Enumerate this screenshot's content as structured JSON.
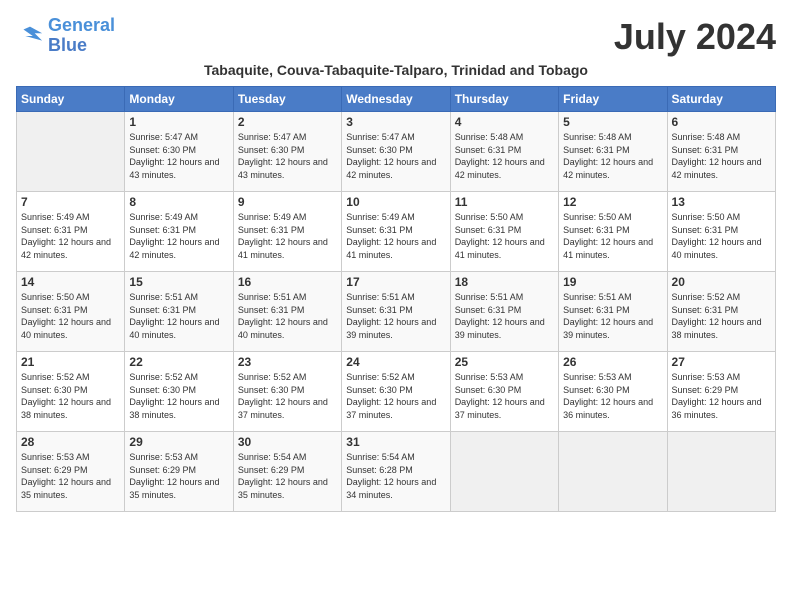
{
  "logo": {
    "text_general": "General",
    "text_blue": "Blue"
  },
  "header": {
    "month_title": "July 2024",
    "subtitle": "Tabaquite, Couva-Tabaquite-Talparo, Trinidad and Tobago"
  },
  "weekdays": [
    "Sunday",
    "Monday",
    "Tuesday",
    "Wednesday",
    "Thursday",
    "Friday",
    "Saturday"
  ],
  "weeks": [
    [
      {
        "day": "",
        "sunrise": "",
        "sunset": "",
        "daylight": ""
      },
      {
        "day": "1",
        "sunrise": "Sunrise: 5:47 AM",
        "sunset": "Sunset: 6:30 PM",
        "daylight": "Daylight: 12 hours and 43 minutes."
      },
      {
        "day": "2",
        "sunrise": "Sunrise: 5:47 AM",
        "sunset": "Sunset: 6:30 PM",
        "daylight": "Daylight: 12 hours and 43 minutes."
      },
      {
        "day": "3",
        "sunrise": "Sunrise: 5:47 AM",
        "sunset": "Sunset: 6:30 PM",
        "daylight": "Daylight: 12 hours and 42 minutes."
      },
      {
        "day": "4",
        "sunrise": "Sunrise: 5:48 AM",
        "sunset": "Sunset: 6:31 PM",
        "daylight": "Daylight: 12 hours and 42 minutes."
      },
      {
        "day": "5",
        "sunrise": "Sunrise: 5:48 AM",
        "sunset": "Sunset: 6:31 PM",
        "daylight": "Daylight: 12 hours and 42 minutes."
      },
      {
        "day": "6",
        "sunrise": "Sunrise: 5:48 AM",
        "sunset": "Sunset: 6:31 PM",
        "daylight": "Daylight: 12 hours and 42 minutes."
      }
    ],
    [
      {
        "day": "7",
        "sunrise": "Sunrise: 5:49 AM",
        "sunset": "Sunset: 6:31 PM",
        "daylight": "Daylight: 12 hours and 42 minutes."
      },
      {
        "day": "8",
        "sunrise": "Sunrise: 5:49 AM",
        "sunset": "Sunset: 6:31 PM",
        "daylight": "Daylight: 12 hours and 42 minutes."
      },
      {
        "day": "9",
        "sunrise": "Sunrise: 5:49 AM",
        "sunset": "Sunset: 6:31 PM",
        "daylight": "Daylight: 12 hours and 41 minutes."
      },
      {
        "day": "10",
        "sunrise": "Sunrise: 5:49 AM",
        "sunset": "Sunset: 6:31 PM",
        "daylight": "Daylight: 12 hours and 41 minutes."
      },
      {
        "day": "11",
        "sunrise": "Sunrise: 5:50 AM",
        "sunset": "Sunset: 6:31 PM",
        "daylight": "Daylight: 12 hours and 41 minutes."
      },
      {
        "day": "12",
        "sunrise": "Sunrise: 5:50 AM",
        "sunset": "Sunset: 6:31 PM",
        "daylight": "Daylight: 12 hours and 41 minutes."
      },
      {
        "day": "13",
        "sunrise": "Sunrise: 5:50 AM",
        "sunset": "Sunset: 6:31 PM",
        "daylight": "Daylight: 12 hours and 40 minutes."
      }
    ],
    [
      {
        "day": "14",
        "sunrise": "Sunrise: 5:50 AM",
        "sunset": "Sunset: 6:31 PM",
        "daylight": "Daylight: 12 hours and 40 minutes."
      },
      {
        "day": "15",
        "sunrise": "Sunrise: 5:51 AM",
        "sunset": "Sunset: 6:31 PM",
        "daylight": "Daylight: 12 hours and 40 minutes."
      },
      {
        "day": "16",
        "sunrise": "Sunrise: 5:51 AM",
        "sunset": "Sunset: 6:31 PM",
        "daylight": "Daylight: 12 hours and 40 minutes."
      },
      {
        "day": "17",
        "sunrise": "Sunrise: 5:51 AM",
        "sunset": "Sunset: 6:31 PM",
        "daylight": "Daylight: 12 hours and 39 minutes."
      },
      {
        "day": "18",
        "sunrise": "Sunrise: 5:51 AM",
        "sunset": "Sunset: 6:31 PM",
        "daylight": "Daylight: 12 hours and 39 minutes."
      },
      {
        "day": "19",
        "sunrise": "Sunrise: 5:51 AM",
        "sunset": "Sunset: 6:31 PM",
        "daylight": "Daylight: 12 hours and 39 minutes."
      },
      {
        "day": "20",
        "sunrise": "Sunrise: 5:52 AM",
        "sunset": "Sunset: 6:31 PM",
        "daylight": "Daylight: 12 hours and 38 minutes."
      }
    ],
    [
      {
        "day": "21",
        "sunrise": "Sunrise: 5:52 AM",
        "sunset": "Sunset: 6:30 PM",
        "daylight": "Daylight: 12 hours and 38 minutes."
      },
      {
        "day": "22",
        "sunrise": "Sunrise: 5:52 AM",
        "sunset": "Sunset: 6:30 PM",
        "daylight": "Daylight: 12 hours and 38 minutes."
      },
      {
        "day": "23",
        "sunrise": "Sunrise: 5:52 AM",
        "sunset": "Sunset: 6:30 PM",
        "daylight": "Daylight: 12 hours and 37 minutes."
      },
      {
        "day": "24",
        "sunrise": "Sunrise: 5:52 AM",
        "sunset": "Sunset: 6:30 PM",
        "daylight": "Daylight: 12 hours and 37 minutes."
      },
      {
        "day": "25",
        "sunrise": "Sunrise: 5:53 AM",
        "sunset": "Sunset: 6:30 PM",
        "daylight": "Daylight: 12 hours and 37 minutes."
      },
      {
        "day": "26",
        "sunrise": "Sunrise: 5:53 AM",
        "sunset": "Sunset: 6:30 PM",
        "daylight": "Daylight: 12 hours and 36 minutes."
      },
      {
        "day": "27",
        "sunrise": "Sunrise: 5:53 AM",
        "sunset": "Sunset: 6:29 PM",
        "daylight": "Daylight: 12 hours and 36 minutes."
      }
    ],
    [
      {
        "day": "28",
        "sunrise": "Sunrise: 5:53 AM",
        "sunset": "Sunset: 6:29 PM",
        "daylight": "Daylight: 12 hours and 35 minutes."
      },
      {
        "day": "29",
        "sunrise": "Sunrise: 5:53 AM",
        "sunset": "Sunset: 6:29 PM",
        "daylight": "Daylight: 12 hours and 35 minutes."
      },
      {
        "day": "30",
        "sunrise": "Sunrise: 5:54 AM",
        "sunset": "Sunset: 6:29 PM",
        "daylight": "Daylight: 12 hours and 35 minutes."
      },
      {
        "day": "31",
        "sunrise": "Sunrise: 5:54 AM",
        "sunset": "Sunset: 6:28 PM",
        "daylight": "Daylight: 12 hours and 34 minutes."
      },
      {
        "day": "",
        "sunrise": "",
        "sunset": "",
        "daylight": ""
      },
      {
        "day": "",
        "sunrise": "",
        "sunset": "",
        "daylight": ""
      },
      {
        "day": "",
        "sunrise": "",
        "sunset": "",
        "daylight": ""
      }
    ]
  ]
}
